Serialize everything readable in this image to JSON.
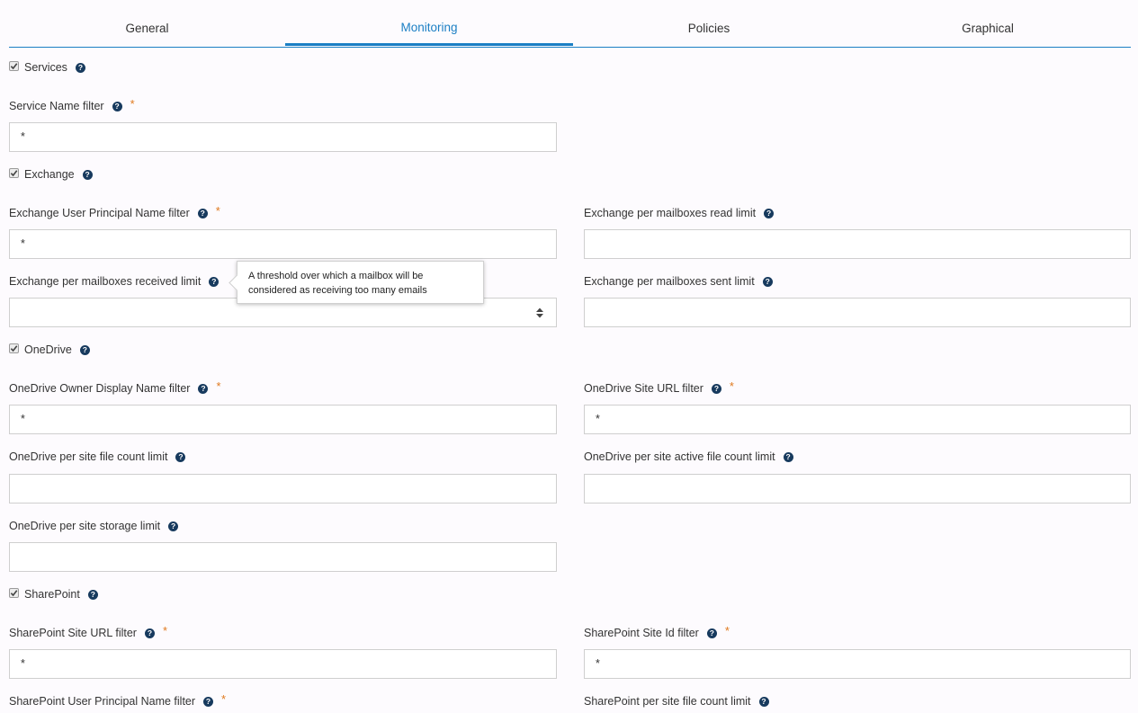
{
  "tabs": [
    "General",
    "Monitoring",
    "Policies",
    "Graphical"
  ],
  "sections": {
    "services": {
      "label": "Services",
      "service_name_filter": {
        "label": "Service Name filter",
        "value": "*"
      }
    },
    "exchange": {
      "label": "Exchange",
      "upn_filter": {
        "label": "Exchange User Principal Name filter",
        "value": "*"
      },
      "read_limit": {
        "label": "Exchange per mailboxes read limit",
        "value": ""
      },
      "received_limit": {
        "label": "Exchange per mailboxes received limit",
        "value": ""
      },
      "sent_limit": {
        "label": "Exchange per mailboxes sent limit",
        "value": ""
      }
    },
    "onedrive": {
      "label": "OneDrive",
      "owner_filter": {
        "label": "OneDrive Owner Display Name filter",
        "value": "*"
      },
      "site_url_filter": {
        "label": "OneDrive Site URL filter",
        "value": "*"
      },
      "file_count_limit": {
        "label": "OneDrive per site file count limit",
        "value": ""
      },
      "active_file_count_limit": {
        "label": "OneDrive per site active file count limit",
        "value": ""
      },
      "storage_limit": {
        "label": "OneDrive per site storage limit",
        "value": ""
      }
    },
    "sharepoint": {
      "label": "SharePoint",
      "site_url_filter": {
        "label": "SharePoint Site URL filter",
        "value": "*"
      },
      "site_id_filter": {
        "label": "SharePoint Site Id filter",
        "value": "*"
      },
      "upn_filter": {
        "label": "SharePoint User Principal Name filter"
      },
      "file_count_limit": {
        "label": "SharePoint per site file count limit"
      }
    }
  },
  "tooltip": {
    "line1": "A threshold over which a mailbox will be",
    "line2": "considered as receiving too many emails"
  },
  "glyphs": {
    "help": "?",
    "required": "*"
  },
  "colors": {
    "accent": "#1b7fc4",
    "help_icon": "#173a5e",
    "required": "#e07a1f"
  }
}
